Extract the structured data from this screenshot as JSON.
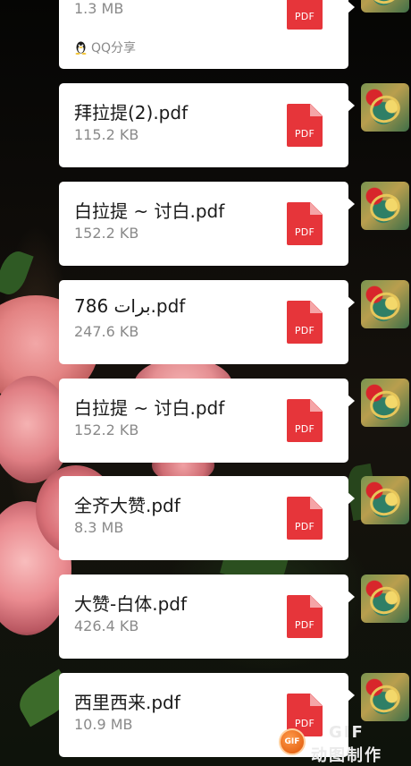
{
  "messages": [
    {
      "file_name": "",
      "size": "1.3 MB",
      "source": "QQ分享",
      "icon_label": "PDF"
    },
    {
      "file_name": "拜拉提(2).pdf",
      "size": "115.2 KB",
      "icon_label": "PDF"
    },
    {
      "file_name": "白拉提 ~ 讨白.pdf",
      "size": "152.2 KB",
      "icon_label": "PDF"
    },
    {
      "file_name": "برات 786.pdf",
      "size": "247.6 KB",
      "icon_label": "PDF"
    },
    {
      "file_name": "白拉提 ~ 讨白.pdf",
      "size": "152.2 KB",
      "icon_label": "PDF"
    },
    {
      "file_name": "全齐大赞.pdf",
      "size": "8.3 MB",
      "icon_label": "PDF"
    },
    {
      "file_name": "大赞-白体.pdf",
      "size": "426.4 KB",
      "icon_label": "PDF"
    },
    {
      "file_name": "西里西来.pdf",
      "size": "10.9 MB",
      "icon_label": "PDF"
    }
  ],
  "icons": {
    "file": "pdf-file-icon",
    "source": "qq-penguin-icon",
    "avatar": "user-avatar"
  },
  "colors": {
    "bubble": "#ffffff",
    "pdf_red": "#e6353a",
    "file_name": "#1a1a1a",
    "meta": "#8a8a8a"
  },
  "watermark": {
    "badge": "GIF",
    "brand": "GIF",
    "brand_cn": "动图制作"
  }
}
